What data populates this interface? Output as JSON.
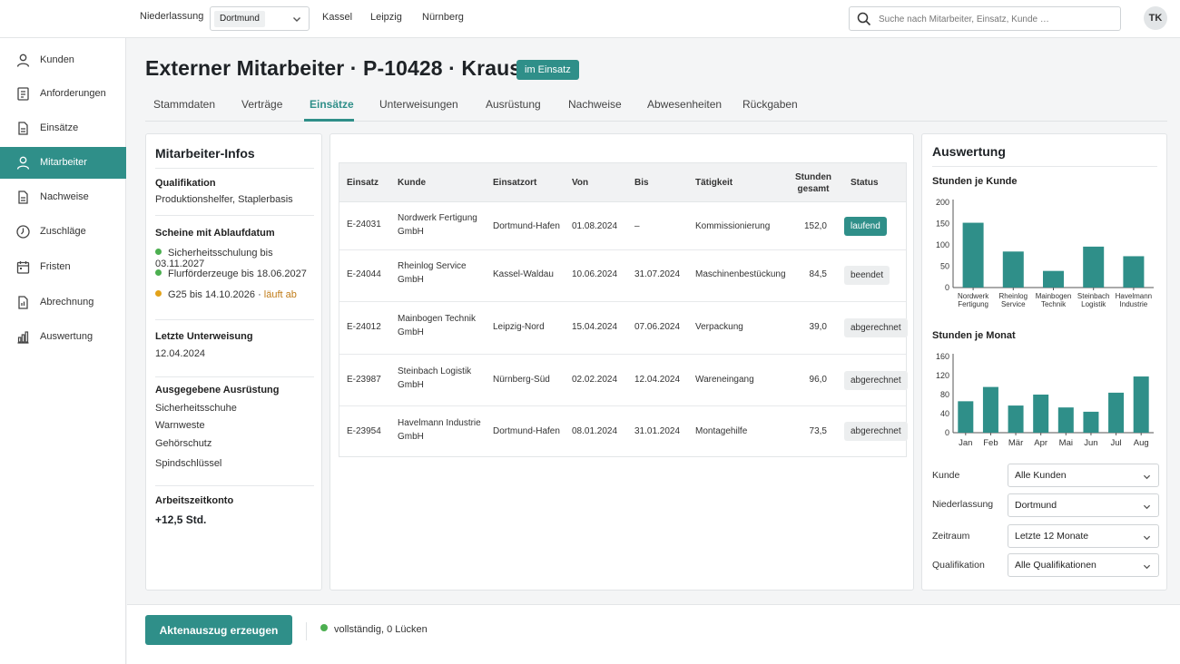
{
  "topbar": {
    "niederlassung_label": "Niederlassung",
    "niederlassung_value": "Dortmund",
    "quick_links": [
      "Kassel",
      "Leipzig",
      "Nürnberg"
    ],
    "search_placeholder": "Suche nach Mitarbeiter, Einsatz, Kunde …",
    "avatar": "TK"
  },
  "sidebar": {
    "items": [
      {
        "label": "Kunden",
        "icon": "user-icon"
      },
      {
        "label": "Anforderungen",
        "icon": "request-icon"
      },
      {
        "label": "Einsätze",
        "icon": "document-icon"
      },
      {
        "label": "Mitarbeiter",
        "icon": "user-icon",
        "active": true
      },
      {
        "label": "Nachweise",
        "icon": "document-icon"
      },
      {
        "label": "Zuschläge",
        "icon": "percent-icon"
      },
      {
        "label": "Fristen",
        "icon": "calendar-icon"
      },
      {
        "label": "Abrechnung",
        "icon": "invoice-icon"
      },
      {
        "label": "Auswertung",
        "icon": "bar-chart-icon"
      }
    ]
  },
  "header": {
    "title": "Externer Mitarbeiter · P-10428 · Krause, T.",
    "status_badge": "im Einsatz"
  },
  "tabs": [
    {
      "label": "Stammdaten"
    },
    {
      "label": "Verträge"
    },
    {
      "label": "Einsätze",
      "active": true
    },
    {
      "label": "Unterweisungen"
    },
    {
      "label": "Ausrüstung"
    },
    {
      "label": "Nachweise"
    },
    {
      "label": "Abwesenheiten"
    },
    {
      "label": "Rückgaben"
    }
  ],
  "info": {
    "title": "Mitarbeiter-Infos",
    "qualifikation_label": "Qualifikation",
    "qualifikation_value": "Produktionshelfer, Staplerbasis",
    "scheine_label": "Scheine mit Ablaufdatum",
    "scheine": [
      {
        "text": "Sicherheitsschulung bis 03.11.2027",
        "color": "#4caf50"
      },
      {
        "text": "Flurförderzeuge bis 18.06.2027",
        "color": "#4caf50"
      },
      {
        "text": "G25 bis 14.10.2026 · ",
        "warn": "läuft ab",
        "color": "#e3a21a"
      }
    ],
    "unterweisung_label": "Letzte Unterweisung",
    "unterweisung_value": "12.04.2024",
    "ausruestung_label": "Ausgegebene Ausrüstung",
    "ausruestung": [
      "Sicherheitsschuhe",
      "Warnweste",
      "Gehörschutz",
      "Spindschlüssel"
    ],
    "konto_label": "Arbeitszeitkonto",
    "konto_value": "+12,5 Std."
  },
  "table": {
    "headers": {
      "einsatz": "Einsatz",
      "kunde": "Kunde",
      "einsatzort": "Einsatzort",
      "von": "Von",
      "bis": "Bis",
      "taetigkeit": "Tätigkeit",
      "stunden_l1": "Stunden",
      "stunden_l2": "gesamt",
      "status": "Status"
    },
    "rows": [
      {
        "einsatz": "E-24031",
        "kunde_l1": "Nordwerk Fertigung",
        "kunde_l2": "GmbH",
        "ort": "Dortmund-Hafen",
        "von": "01.08.2024",
        "bis": "–",
        "taetigkeit": "Kommissionierung",
        "stunden": "152,0",
        "status": "laufend"
      },
      {
        "einsatz": "E-24044",
        "kunde_l1": "Rheinlog Service",
        "kunde_l2": "GmbH",
        "ort": "Kassel-Waldau",
        "von": "10.06.2024",
        "bis": "31.07.2024",
        "taetigkeit": "Maschinenbestückung",
        "stunden": "84,5",
        "status": "beendet"
      },
      {
        "einsatz": "E-24012",
        "kunde_l1": "Mainbogen Technik",
        "kunde_l2": "GmbH",
        "ort": "Leipzig-Nord",
        "von": "15.04.2024",
        "bis": "07.06.2024",
        "taetigkeit": "Verpackung",
        "stunden": "39,0",
        "status": "abgerechnet"
      },
      {
        "einsatz": "E-23987",
        "kunde_l1": "Steinbach Logistik",
        "kunde_l2": "GmbH",
        "ort": "Nürnberg-Süd",
        "von": "02.02.2024",
        "bis": "12.04.2024",
        "taetigkeit": "Wareneingang",
        "stunden": "96,0",
        "status": "abgerechnet"
      },
      {
        "einsatz": "E-23954",
        "kunde_l1": "Havelmann Industrie",
        "kunde_l2": "GmbH",
        "ort": "Dortmund-Hafen",
        "von": "08.01.2024",
        "bis": "31.01.2024",
        "taetigkeit": "Montagehilfe",
        "stunden": "73,5",
        "status": "abgerechnet"
      }
    ]
  },
  "auswertung": {
    "title": "Auswertung",
    "filters": [
      {
        "label": "Kunde",
        "value": "Alle Kunden"
      },
      {
        "label": "Niederlassung",
        "value": "Dortmund"
      },
      {
        "label": "Zeitraum",
        "value": "Letzte 12 Monate"
      },
      {
        "label": "Qualifikation",
        "value": "Alle Qualifikationen"
      }
    ]
  },
  "chart_data": [
    {
      "type": "bar",
      "title": "Stunden je Kunde",
      "categories": [
        [
          "Nordwerk",
          "Fertigung"
        ],
        [
          "Rheinlog",
          "Service"
        ],
        [
          "Mainbogen",
          "Technik"
        ],
        [
          "Steinbach",
          "Logistik"
        ],
        [
          "Havelmann",
          "Industrie"
        ]
      ],
      "values": [
        152,
        84.5,
        39,
        96,
        73.5
      ],
      "ylim": [
        0,
        200
      ],
      "yticks": [
        0,
        50,
        100,
        150,
        200
      ],
      "grid": false,
      "color": "#2f8f89"
    },
    {
      "type": "bar",
      "title": "Stunden je Monat",
      "categories": [
        "Jan",
        "Feb",
        "Mär",
        "Apr",
        "Mai",
        "Jun",
        "Jul",
        "Aug"
      ],
      "values": [
        66,
        96,
        57,
        80,
        53,
        44,
        84,
        118
      ],
      "ylim": [
        0,
        160
      ],
      "yticks": [
        0,
        40,
        80,
        120,
        160
      ],
      "grid": false,
      "color": "#2f8f89"
    }
  ],
  "footer": {
    "button": "Aktenauszug erzeugen",
    "status": "vollständig, 0 Lücken",
    "status_color": "#4caf50"
  }
}
